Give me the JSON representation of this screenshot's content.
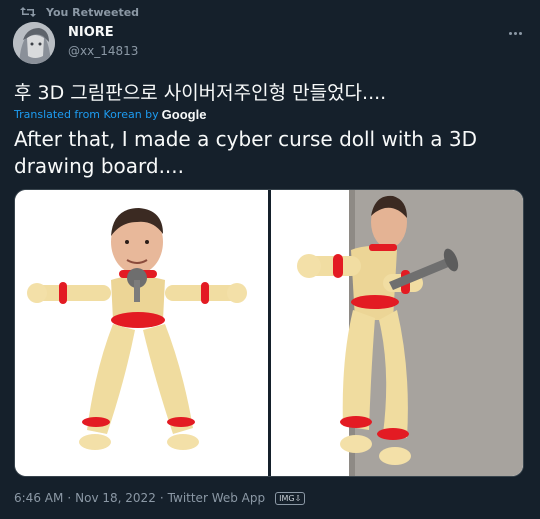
{
  "retweet": {
    "label": "You Retweeted",
    "icon": "retweet-icon"
  },
  "author": {
    "name": "NIORE",
    "handle": "@xx_14813",
    "avatar_icon": "avatar-image"
  },
  "more": {
    "icon": "more-options-icon"
  },
  "tweet": {
    "original_text": "후 3D 그림판으로 사이버저주인형 만들었다....",
    "translation_label": "Translated from Korean by",
    "translation_provider": "Google",
    "translated_text": "After that, I made a cyber curse doll with a 3D drawing board...."
  },
  "media": {
    "images": [
      {
        "description": "curse-doll-front",
        "icon": "doll-front-image"
      },
      {
        "description": "curse-doll-side-with-nail",
        "icon": "doll-side-image"
      }
    ]
  },
  "meta": {
    "time": "6:46 AM",
    "separator": "·",
    "date": "Nov 18, 2022",
    "client": "Twitter Web App",
    "badge": "IMG",
    "badge_suffix": "⇩"
  },
  "colors": {
    "background": "#15202b",
    "text": "#f7f9f9",
    "muted": "#8b98a5",
    "link": "#1d9bf0",
    "straw": "#f2dfa6",
    "band": "#e31b23"
  }
}
